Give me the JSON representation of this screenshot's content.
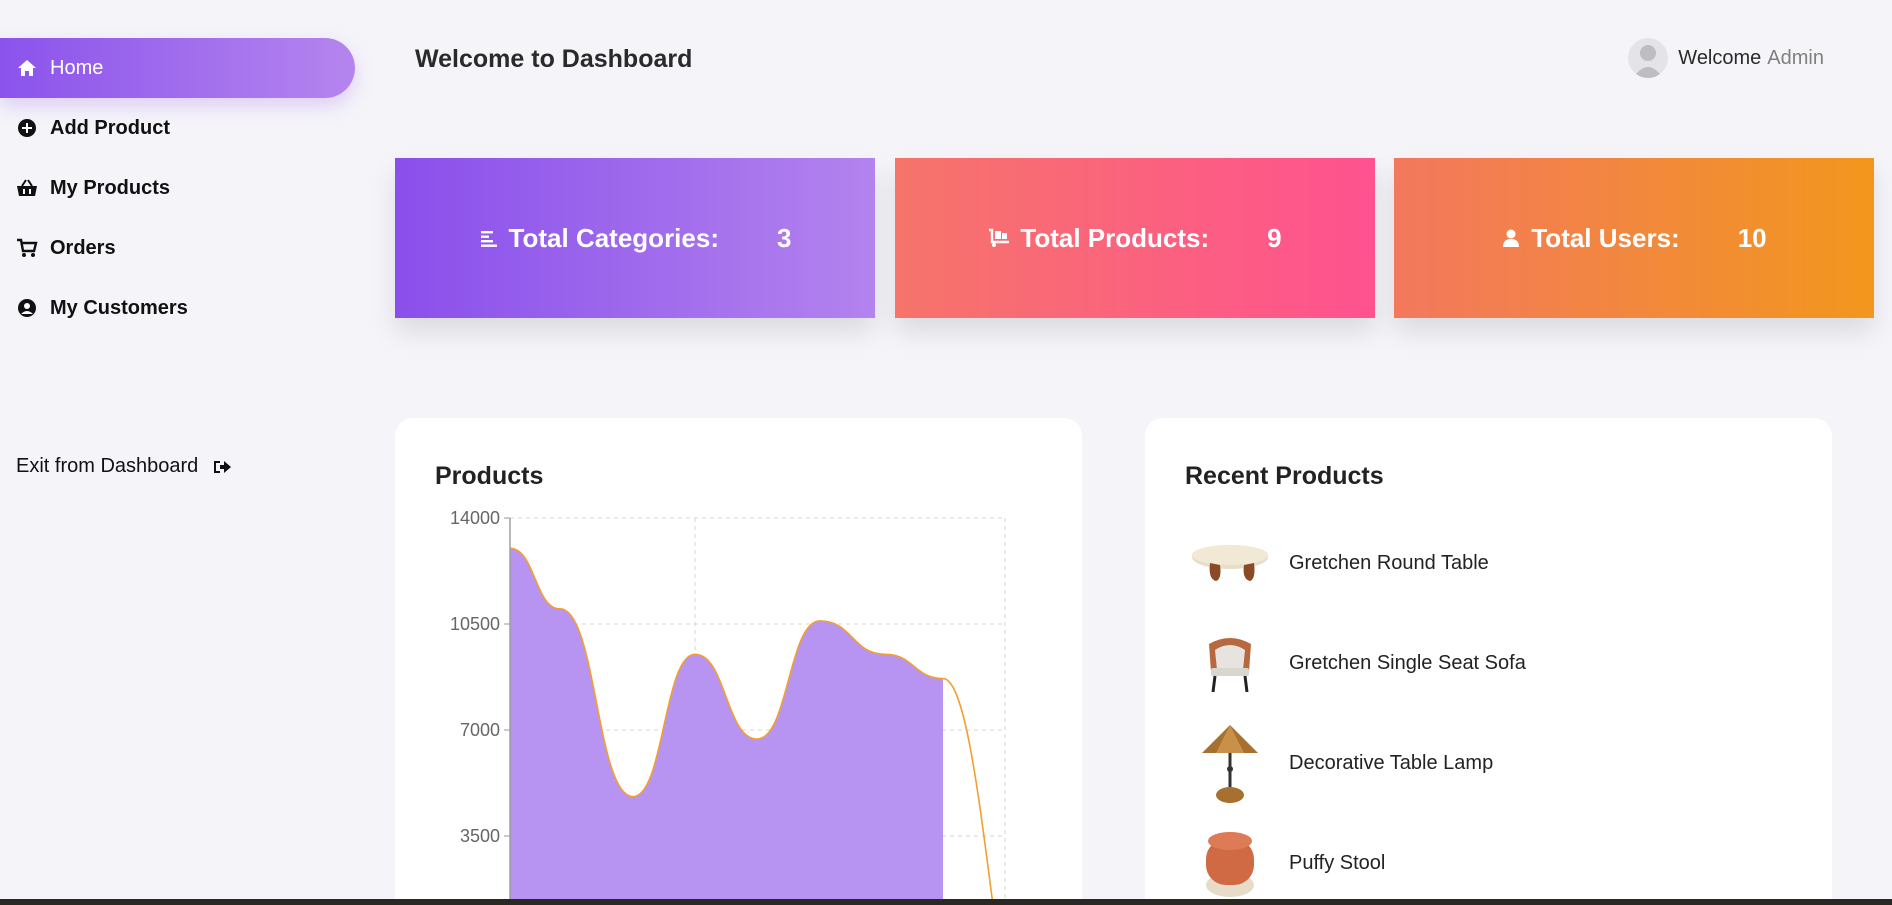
{
  "sidebar": {
    "items": [
      {
        "label": "Home",
        "icon": "home-icon",
        "active": true
      },
      {
        "label": "Add Product",
        "icon": "plus-circle-icon",
        "active": false
      },
      {
        "label": "My Products",
        "icon": "basket-icon",
        "active": false
      },
      {
        "label": "Orders",
        "icon": "cart-icon",
        "active": false
      },
      {
        "label": "My Customers",
        "icon": "user-circle-icon",
        "active": false
      }
    ],
    "exit_label": "Exit from Dashboard"
  },
  "header": {
    "title": "Welcome to Dashboard",
    "welcome": "Welcome",
    "username": "Admin"
  },
  "stats": [
    {
      "label": "Total Categories:",
      "value": "3",
      "icon": "list-icon"
    },
    {
      "label": "Total Products:",
      "value": "9",
      "icon": "dolly-icon"
    },
    {
      "label": "Total Users:",
      "value": "10",
      "icon": "user-icon"
    }
  ],
  "products_panel": {
    "title": "Products"
  },
  "recent_panel": {
    "title": "Recent Products",
    "items": [
      {
        "name": "Gretchen Round Table",
        "icon": "table-thumbnail"
      },
      {
        "name": "Gretchen Single Seat Sofa",
        "icon": "sofa-thumbnail"
      },
      {
        "name": "Decorative Table Lamp",
        "icon": "lamp-thumbnail"
      },
      {
        "name": "Puffy Stool",
        "icon": "stool-thumbnail"
      }
    ]
  },
  "colors": {
    "accent_purple": "#8b53ec",
    "stat_pink": "#ff5290",
    "stat_orange": "#f2971d",
    "chart_fill": "#b794f2",
    "chart_line": "#f0a030"
  },
  "chart_data": {
    "type": "area",
    "y_ticks": [
      "14000",
      "10500",
      "7000",
      "3500"
    ],
    "ylim": [
      0,
      14000
    ],
    "series": [
      {
        "values": [
          13000,
          11000,
          4800,
          9500,
          6700,
          10600,
          9500,
          8700
        ]
      },
      {
        "values": [
          8700,
          0
        ]
      }
    ],
    "grid": true
  }
}
